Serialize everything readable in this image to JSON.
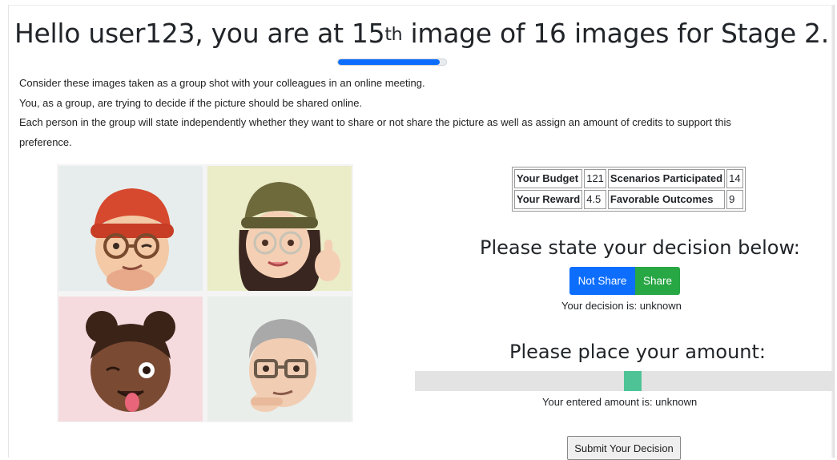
{
  "header": {
    "title_before": "Hello user123, you are at 15",
    "title_sup": "th",
    "title_after": " image of 16 images for Stage 2.",
    "progress": {
      "current": 15,
      "total": 16,
      "fraction": 0.94,
      "color": "#0d6efd"
    }
  },
  "intro": {
    "line1": "Consider these images taken as a group shot with your colleagues in an online meeting.",
    "line2": "You, as a group, are trying to decide if the picture should be shared online.",
    "line3": "Each person in the group will state independently whether they want to share or not share the picture as well as assign an amount of credits to support this preference."
  },
  "photos": [
    {
      "name": "man-red-beanie-avatar"
    },
    {
      "name": "woman-olive-beanie-avatar"
    },
    {
      "name": "girl-winking-avatar"
    },
    {
      "name": "grey-haired-man-avatar"
    }
  ],
  "stats": {
    "budget_label": "Your Budget",
    "budget_value": "121",
    "scenarios_label": "Scenarios Participated",
    "scenarios_value": "14",
    "reward_label": "Your Reward",
    "reward_value": "4.5",
    "favorable_label": "Favorable Outcomes",
    "favorable_value": "9"
  },
  "decision": {
    "heading": "Please state your decision below:",
    "not_share_label": "Not Share",
    "share_label": "Share",
    "status": "Your decision is: unknown",
    "colors": {
      "not_share": "#0d6efd",
      "share": "#28a745"
    }
  },
  "amount": {
    "heading": "Please place your amount:",
    "slider_fraction": 0.52,
    "status": "Your entered amount is: unknown",
    "thumb_color": "#4ec496"
  },
  "submit": {
    "label": "Submit Your Decision"
  }
}
